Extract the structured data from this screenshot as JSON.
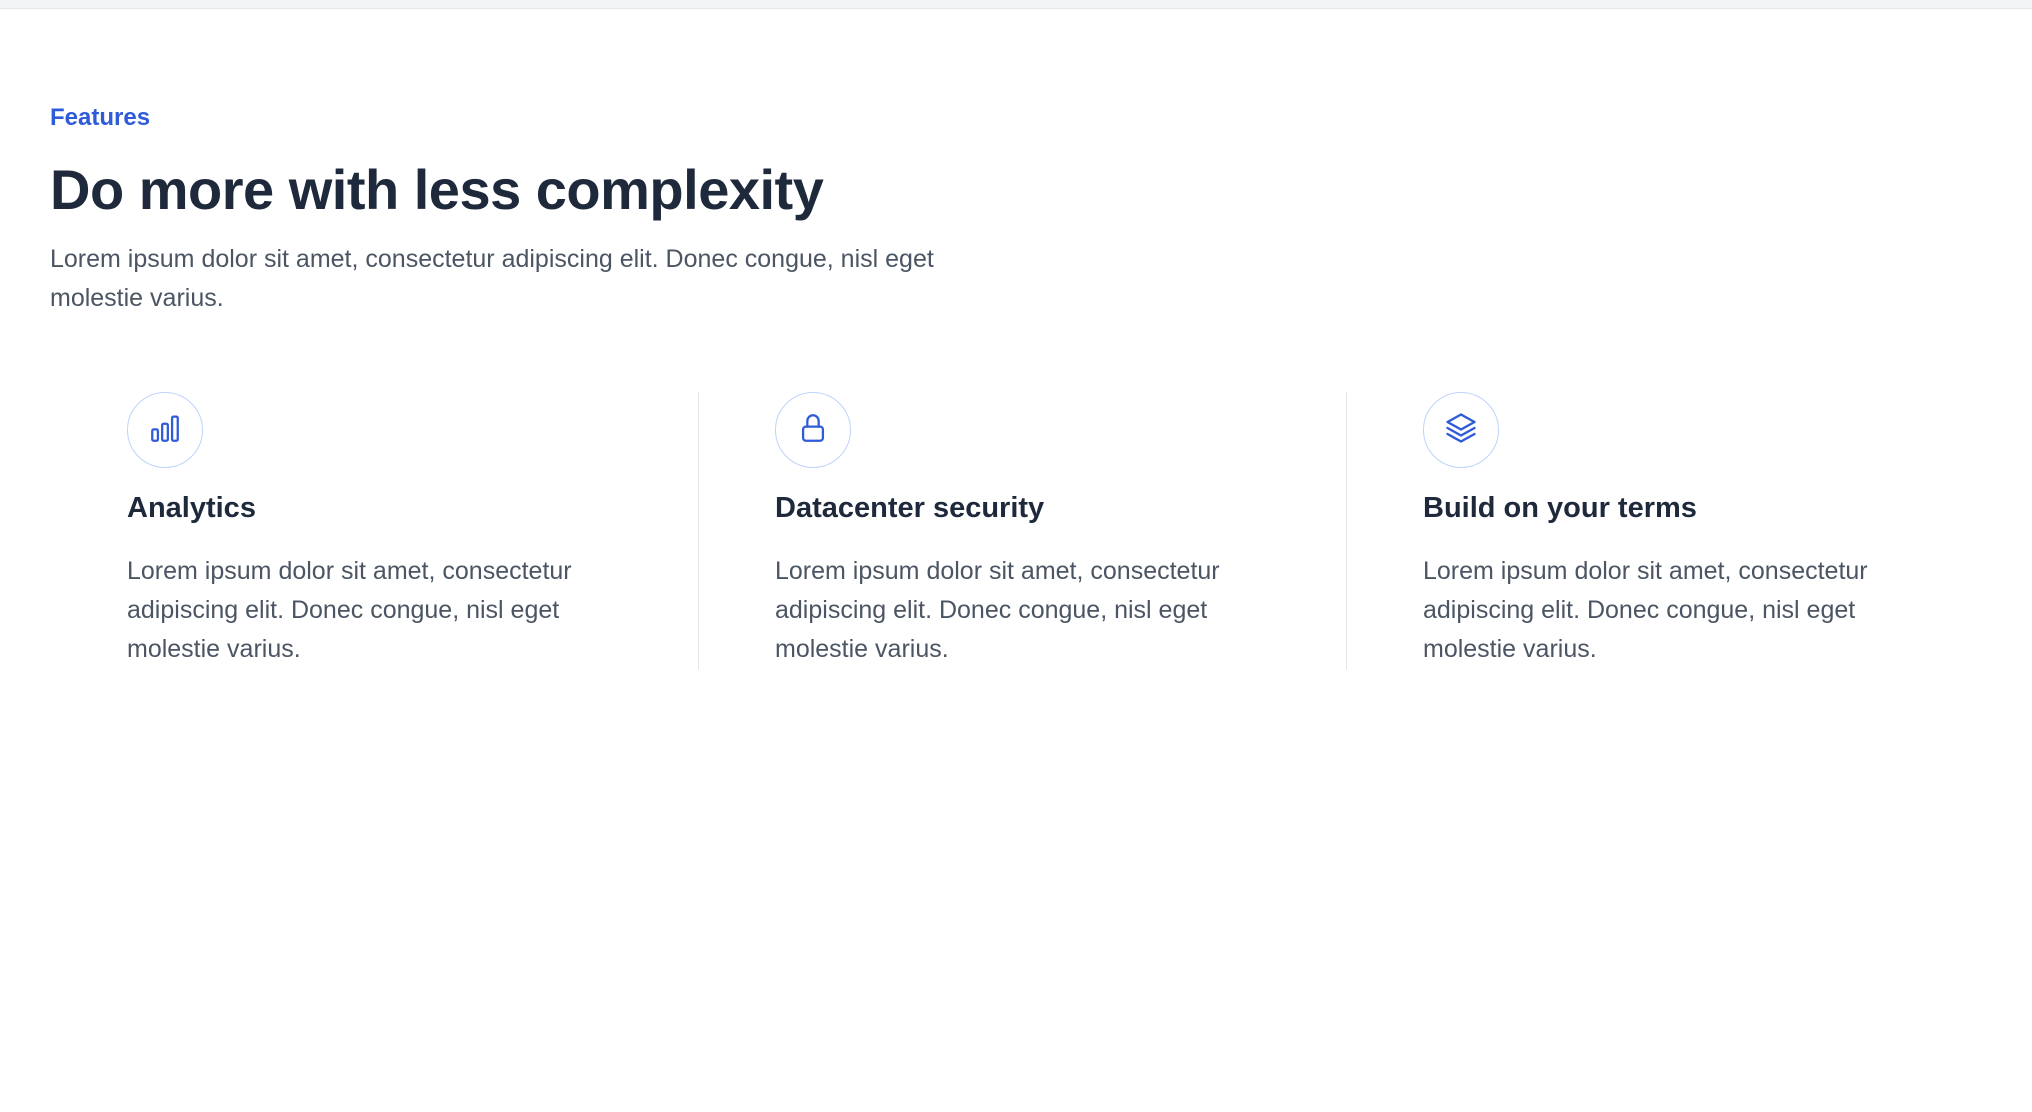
{
  "colors": {
    "accent": "#2f5bd8",
    "heading": "#1e293b",
    "body_text": "#4b5563",
    "icon_ring": "#bfd3fb",
    "divider": "#e5e7eb"
  },
  "header": {
    "eyebrow": "Features",
    "title": "Do more with less complexity",
    "description": "Lorem ipsum dolor sit amet, consectetur adipiscing elit. Donec congue, nisl eget molestie varius."
  },
  "features": [
    {
      "icon": "bar-chart-icon",
      "title": "Analytics",
      "description": "Lorem ipsum dolor sit amet, consectetur adipiscing elit. Donec congue, nisl eget molestie varius."
    },
    {
      "icon": "lock-icon",
      "title": "Datacenter security",
      "description": "Lorem ipsum dolor sit amet, consectetur adipiscing elit. Donec congue, nisl eget molestie varius."
    },
    {
      "icon": "layers-icon",
      "title": "Build on your terms",
      "description": "Lorem ipsum dolor sit amet, consectetur adipiscing elit. Donec congue, nisl eget molestie varius."
    }
  ]
}
